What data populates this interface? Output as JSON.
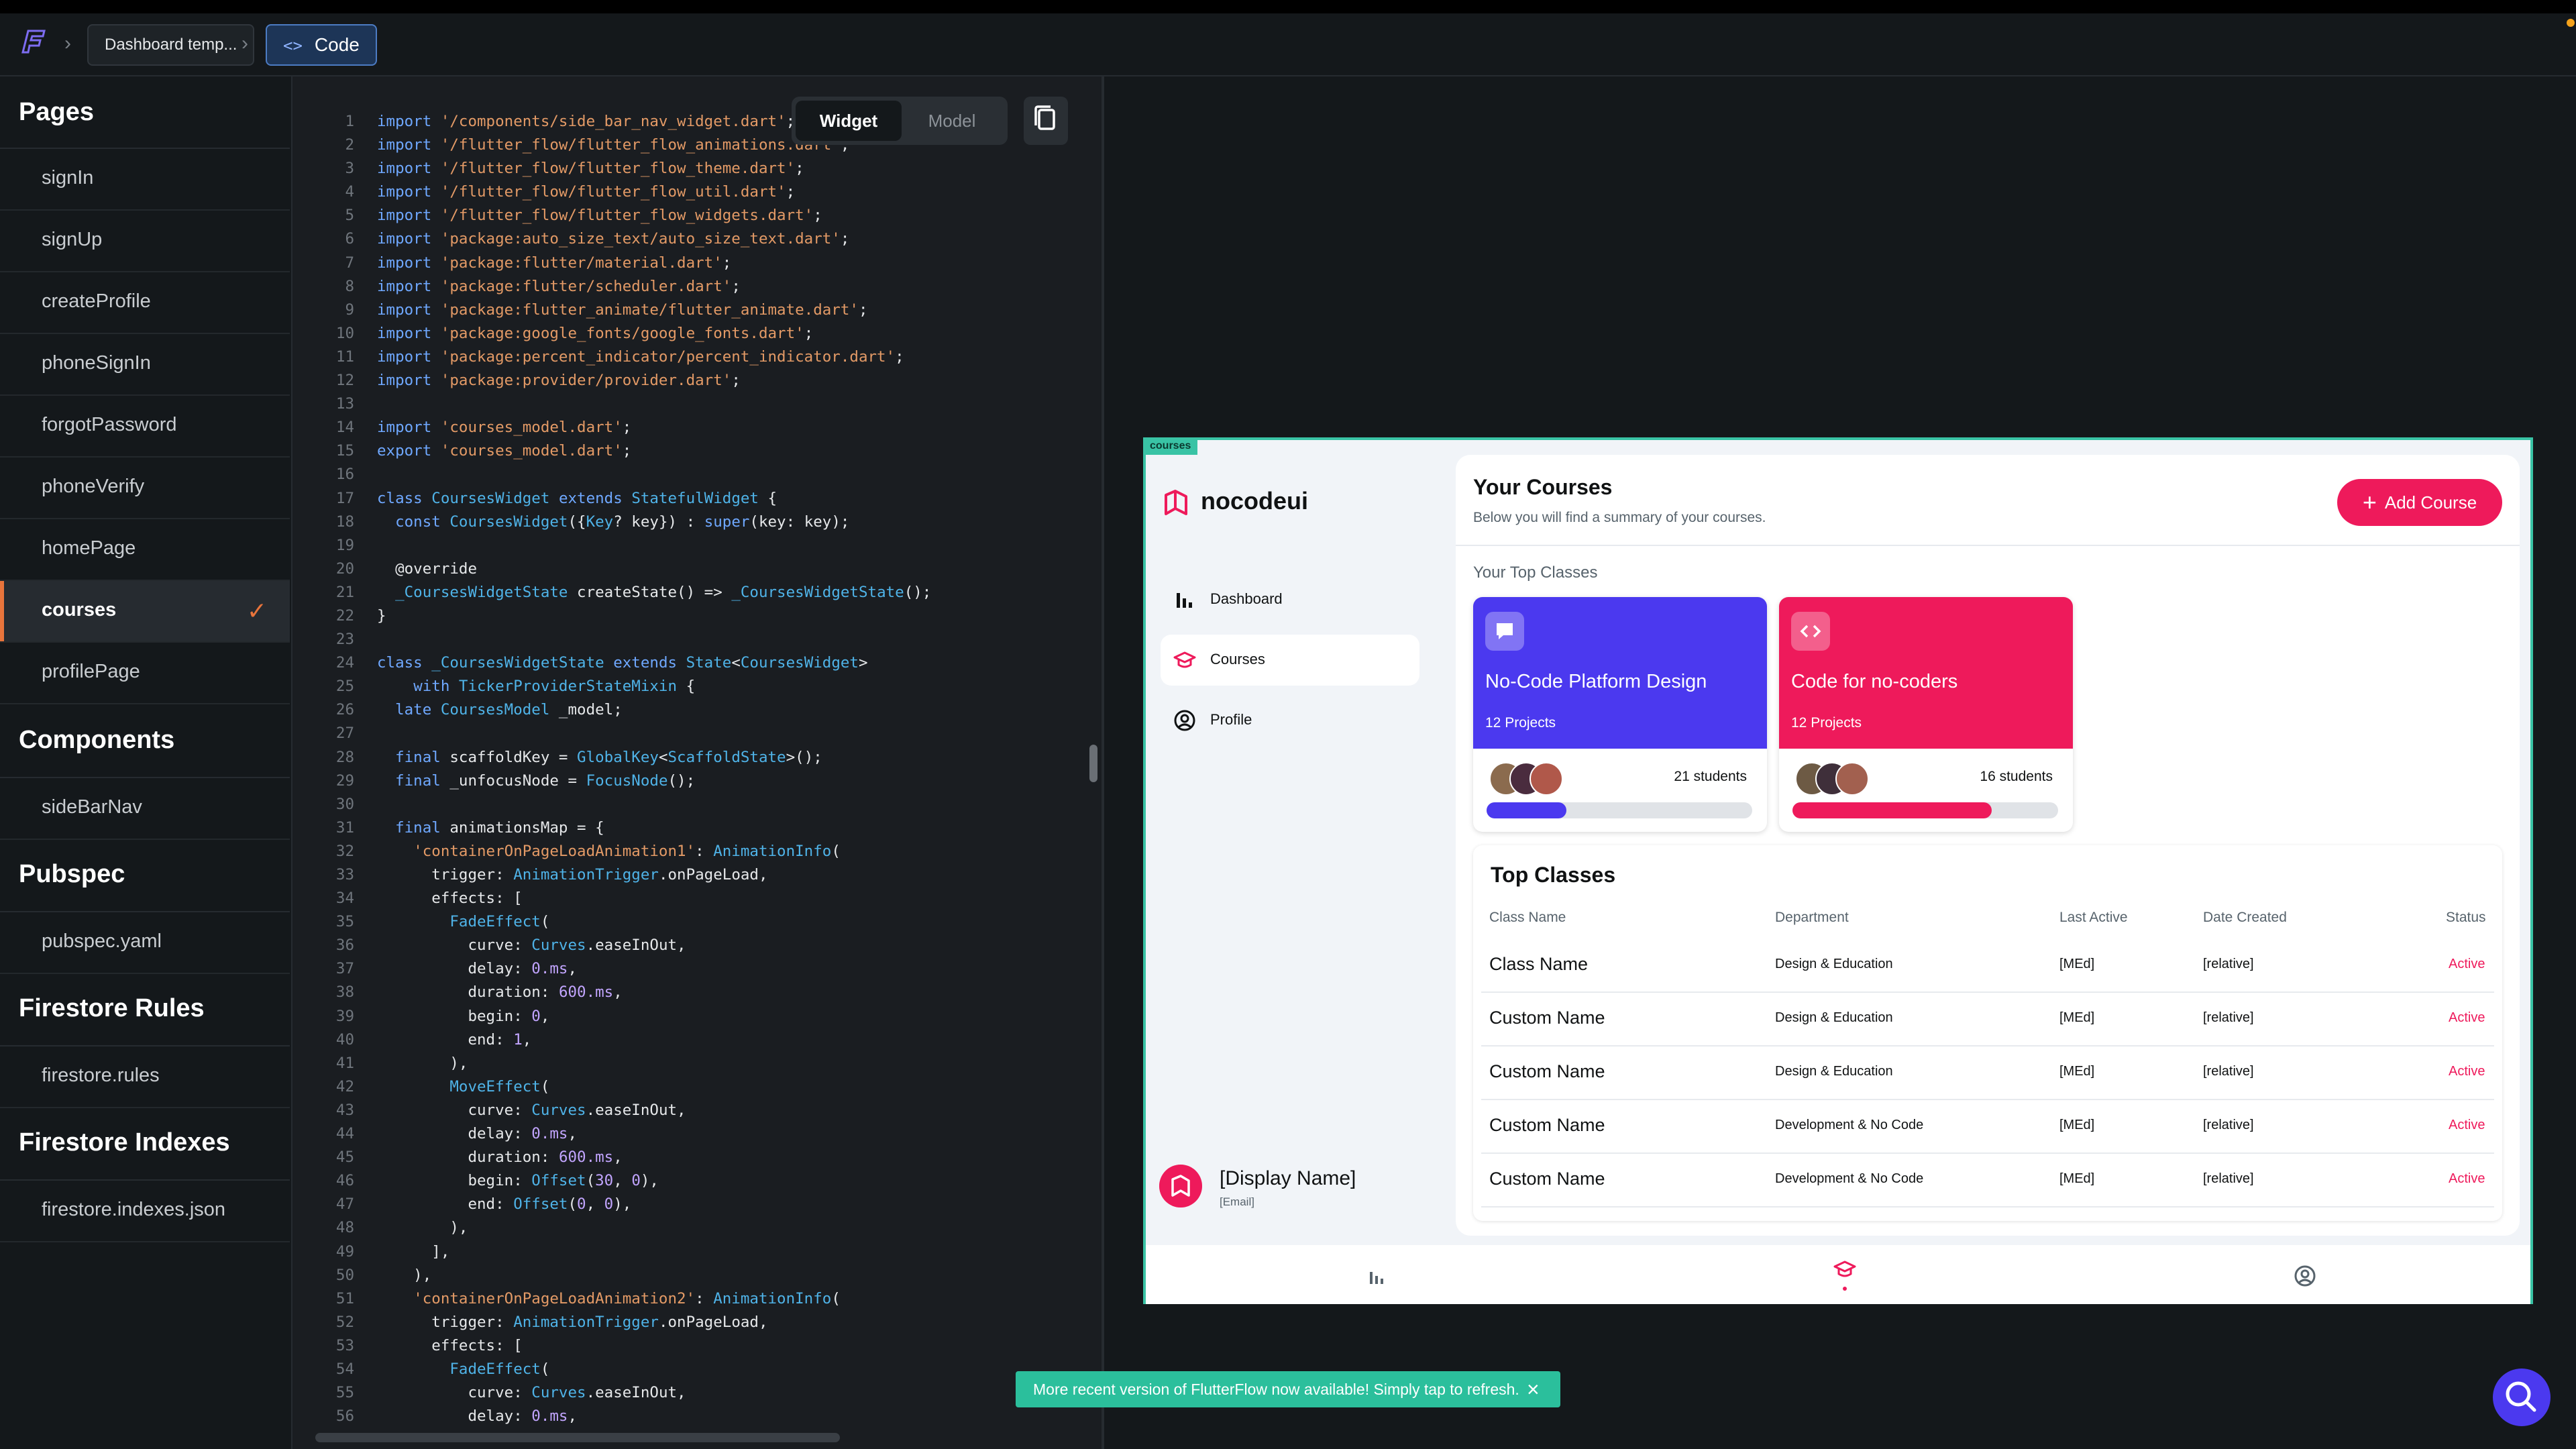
{
  "header": {
    "breadcrumb_page": "Dashboard temp...",
    "breadcrumb_code": "Code",
    "code_icon": "code-icon"
  },
  "sidebar": {
    "pages_title": "Pages",
    "pages": [
      "signIn",
      "signUp",
      "createProfile",
      "phoneSignIn",
      "forgotPassword",
      "phoneVerify",
      "homePage",
      "courses",
      "profilePage"
    ],
    "selected_page": "courses",
    "components_title": "Components",
    "components": [
      "sideBarNav"
    ],
    "pubspec_title": "Pubspec",
    "pubspec": [
      "pubspec.yaml"
    ],
    "firestore_rules_title": "Firestore Rules",
    "firestore_rules": [
      "firestore.rules"
    ],
    "firestore_indexes_title": "Firestore Indexes",
    "firestore_indexes": [
      "firestore.indexes.json"
    ]
  },
  "editor": {
    "tab_widget": "Widget",
    "tab_model": "Model",
    "lines": [
      "import '/components/side_bar_nav_widget.dart';",
      "import '/flutter_flow/flutter_flow_animations.dart';",
      "import '/flutter_flow/flutter_flow_theme.dart';",
      "import '/flutter_flow/flutter_flow_util.dart';",
      "import '/flutter_flow/flutter_flow_widgets.dart';",
      "import 'package:auto_size_text/auto_size_text.dart';",
      "import 'package:flutter/material.dart';",
      "import 'package:flutter/scheduler.dart';",
      "import 'package:flutter_animate/flutter_animate.dart';",
      "import 'package:google_fonts/google_fonts.dart';",
      "import 'package:percent_indicator/percent_indicator.dart';",
      "import 'package:provider/provider.dart';",
      "",
      "import 'courses_model.dart';",
      "export 'courses_model.dart';",
      "",
      "class CoursesWidget extends StatefulWidget {",
      "  const CoursesWidget({Key? key}) : super(key: key);",
      "",
      "  @override",
      "  _CoursesWidgetState createState() => _CoursesWidgetState();",
      "}",
      "",
      "class _CoursesWidgetState extends State<CoursesWidget>",
      "    with TickerProviderStateMixin {",
      "  late CoursesModel _model;",
      "",
      "  final scaffoldKey = GlobalKey<ScaffoldState>();",
      "  final _unfocusNode = FocusNode();",
      "",
      "  final animationsMap = {",
      "    'containerOnPageLoadAnimation1': AnimationInfo(",
      "      trigger: AnimationTrigger.onPageLoad,",
      "      effects: [",
      "        FadeEffect(",
      "          curve: Curves.easeInOut,",
      "          delay: 0.ms,",
      "          duration: 600.ms,",
      "          begin: 0,",
      "          end: 1,",
      "        ),",
      "        MoveEffect(",
      "          curve: Curves.easeInOut,",
      "          delay: 0.ms,",
      "          duration: 600.ms,",
      "          begin: Offset(30, 0),",
      "          end: Offset(0, 0),",
      "        ),",
      "      ],",
      "    ),",
      "    'containerOnPageLoadAnimation2': AnimationInfo(",
      "      trigger: AnimationTrigger.onPageLoad,",
      "      effects: [",
      "        FadeEffect(",
      "          curve: Curves.easeInOut,",
      "          delay: 0.ms,"
    ]
  },
  "preview": {
    "tag": "courses",
    "brand": "nocodeui",
    "nav": [
      {
        "label": "Dashboard",
        "icon": "bar-chart-icon"
      },
      {
        "label": "Courses",
        "icon": "graduation-cap-icon"
      },
      {
        "label": "Profile",
        "icon": "account-circle-icon"
      }
    ],
    "user_name": "[Display Name]",
    "user_email": "[Email]",
    "title": "Your Courses",
    "subtitle": "Below you will find a summary of your courses.",
    "add_course": "Add Course",
    "top_classes_label": "Your Top Classes",
    "cards": [
      {
        "title": "No-Code Platform Design",
        "projects": "12 Projects",
        "students": "21 students",
        "progress": 0.3,
        "color": "#4b39ef",
        "icon": "chat-icon"
      },
      {
        "title": "Code for no-coders",
        "projects": "12 Projects",
        "students": "16 students",
        "progress": 0.75,
        "color": "#ee1a5b",
        "icon": "code-icon"
      }
    ],
    "table": {
      "title": "Top Classes",
      "headers": [
        "Class Name",
        "Department",
        "Last Active",
        "Date Created",
        "Status"
      ],
      "rows": [
        [
          "Class Name",
          "Design & Education",
          "[MEd]",
          "[relative]",
          "Active"
        ],
        [
          "Custom Name",
          "Design & Education",
          "[MEd]",
          "[relative]",
          "Active"
        ],
        [
          "Custom Name",
          "Design & Education",
          "[MEd]",
          "[relative]",
          "Active"
        ],
        [
          "Custom Name",
          "Development & No Code",
          "[MEd]",
          "[relative]",
          "Active"
        ],
        [
          "Custom Name",
          "Development & No Code",
          "[MEd]",
          "[relative]",
          "Active"
        ]
      ]
    }
  },
  "toast": {
    "text": "More recent version of FlutterFlow now available! Simply tap to refresh.",
    "close_icon": "close-icon"
  },
  "colors": {
    "accent": "#e8743b",
    "primary": "#4b39ef",
    "secondary": "#ee1a5b",
    "tertiary": "#39c3a5"
  }
}
